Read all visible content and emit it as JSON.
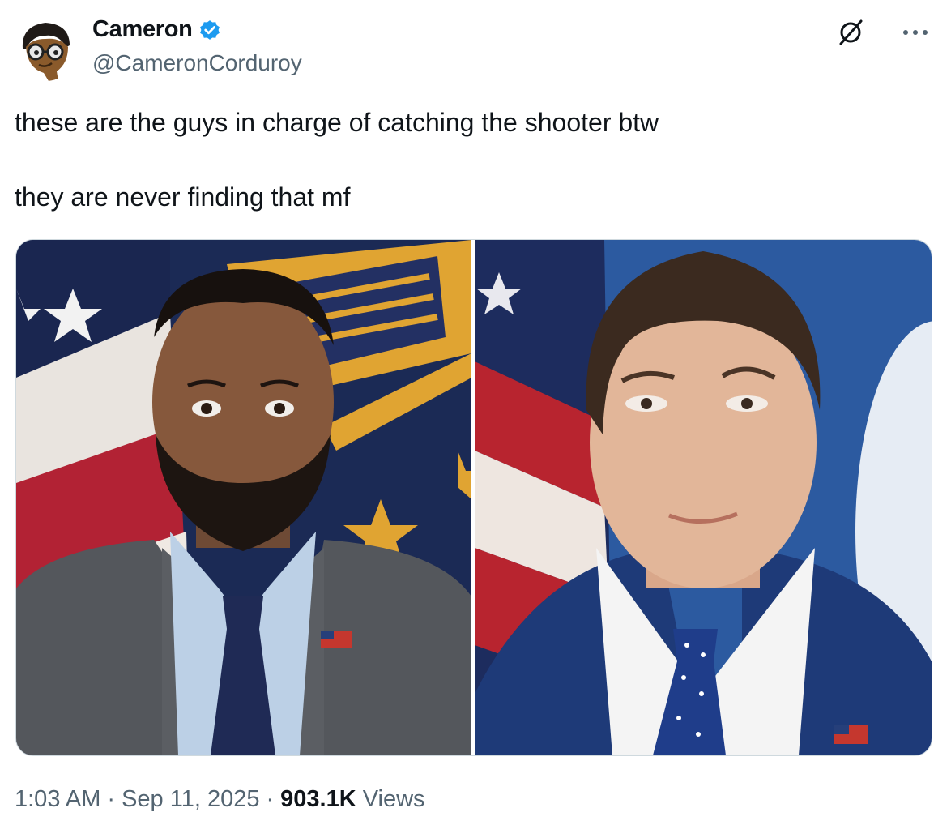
{
  "author": {
    "name": "Cameron",
    "handle": "@CameronCorduroy",
    "verified": true,
    "avatar_icon": "cartoon-avatar-icon"
  },
  "header_actions": {
    "grok_icon": "grok-icon",
    "more_icon": "more-options-icon"
  },
  "tweet": {
    "text_line_1": "these are the guys in charge of catching the shooter btw",
    "text_line_2": "they are never finding that mf"
  },
  "media": {
    "left_photo_icon": "photo-man-gray-suit",
    "right_photo_icon": "photo-man-navy-suit"
  },
  "meta": {
    "time": "1:03 AM",
    "date": "Sep 11, 2025",
    "views_count": "903.1K",
    "views_label": "Views",
    "separator": "·"
  },
  "colors": {
    "verified_blue": "#1d9bf0",
    "secondary_text": "#536471",
    "primary_text": "#0f1419",
    "border": "#cfd9de"
  }
}
